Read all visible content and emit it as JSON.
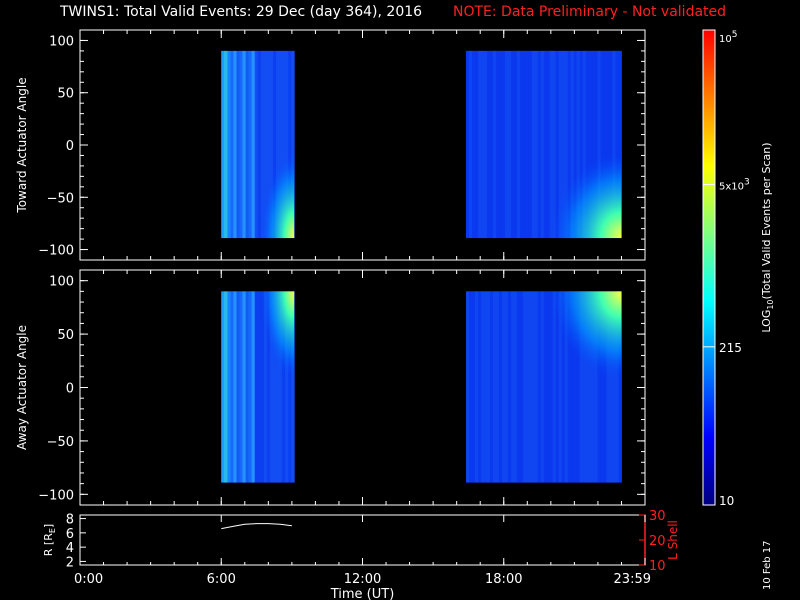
{
  "title": "TWINS1: Total Valid Events: 29 Dec (day 364), 2016",
  "note": "NOTE: Data Preliminary - Not validated",
  "print_date": "10 Feb 17",
  "colors": {
    "background": "#000000",
    "axis": "#ffffff",
    "note": "#ff2020",
    "lshell": "#ff2020"
  },
  "chart_data": [
    {
      "type": "heatmap",
      "ylabel": "Toward Actuator Angle",
      "ylim": [
        -110,
        110
      ],
      "yticks": [
        -100,
        -50,
        0,
        50,
        100
      ],
      "xlim": [
        0,
        24
      ],
      "xticks": [
        0,
        6,
        12,
        18,
        24
      ],
      "data_blocks": [
        {
          "t_start": 6.0,
          "t_end": 9.1,
          "angle_min": -89,
          "angle_max": 90,
          "level": "low-mid",
          "hotspot": "bottom-right"
        },
        {
          "t_start": 16.4,
          "t_end": 23.0,
          "angle_min": -89,
          "angle_max": 90,
          "level": "low",
          "hotspot": "bottom-right"
        }
      ]
    },
    {
      "type": "heatmap",
      "ylabel": "Away Actuator Angle",
      "ylim": [
        -110,
        110
      ],
      "yticks": [
        -100,
        -50,
        0,
        50,
        100
      ],
      "xlim": [
        0,
        24
      ],
      "xticks": [
        0,
        6,
        12,
        18,
        24
      ],
      "data_blocks": [
        {
          "t_start": 6.0,
          "t_end": 9.1,
          "angle_min": -89,
          "angle_max": 90,
          "level": "low-mid",
          "hotspot": "top-right"
        },
        {
          "t_start": 16.4,
          "t_end": 23.0,
          "angle_min": -89,
          "angle_max": 90,
          "level": "low",
          "hotspot": "top-right"
        }
      ]
    },
    {
      "type": "line",
      "ylabel_left": "R [R",
      "ylabel_left_sub": "E",
      "ylabel_left_close": "]",
      "ylabel_right": "L Shell",
      "ylim_left": [
        1.5,
        8.5
      ],
      "yticks_left": [
        2,
        4,
        6,
        8
      ],
      "ylim_right": [
        10,
        30
      ],
      "yticks_right": [
        10,
        20,
        30
      ],
      "xlabel": "Time (UT)",
      "xticks": [
        0,
        6,
        12,
        18,
        24
      ],
      "xtick_labels": [
        "0:00",
        "6:00",
        "12:00",
        "18:00",
        "23:59"
      ],
      "x": [
        6.0,
        6.5,
        7.0,
        7.5,
        8.0,
        8.5,
        9.0
      ],
      "r_values": [
        6.6,
        6.9,
        7.2,
        7.3,
        7.3,
        7.2,
        7.0
      ]
    }
  ],
  "colorbar": {
    "label": "LOG",
    "label_sub": "10",
    "label_rest": "(Total Valid Events per Scan)",
    "ticks": [
      {
        "value": 1,
        "text": "10"
      },
      {
        "value": 2.332,
        "text": "215"
      },
      {
        "value": 3.699,
        "base": "5x10",
        "sup": "3"
      },
      {
        "value": 5,
        "base": "10",
        "sup": "5"
      }
    ],
    "range": [
      1,
      5
    ],
    "colors": [
      "#00007f",
      "#0000ff",
      "#007fff",
      "#00ffff",
      "#7fff7f",
      "#ffff00",
      "#ff7f00",
      "#ff0000"
    ]
  }
}
